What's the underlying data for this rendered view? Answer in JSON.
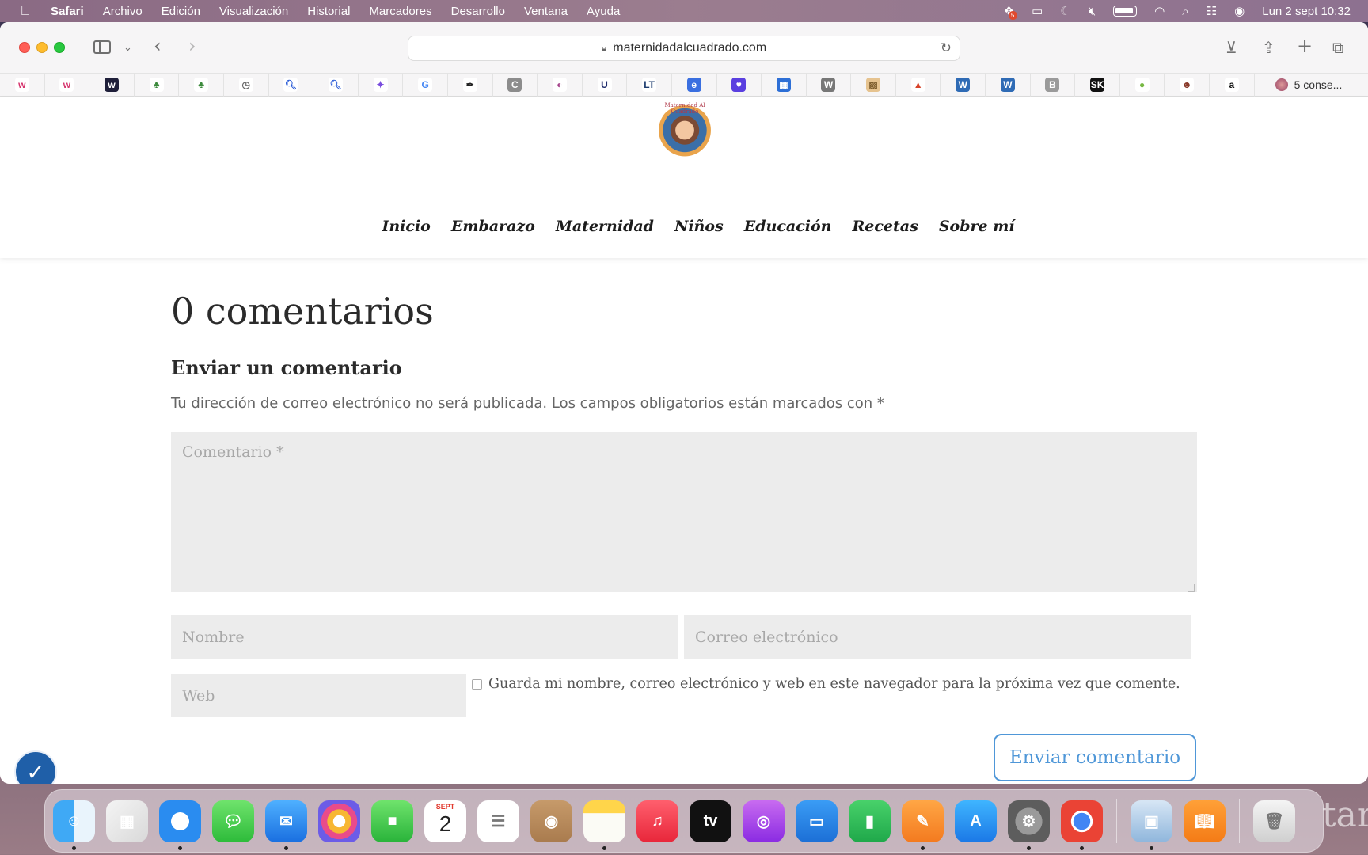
{
  "menubar": {
    "app": "Safari",
    "items": [
      "Archivo",
      "Edición",
      "Visualización",
      "Historial",
      "Marcadores",
      "Desarrollo",
      "Ventana",
      "Ayuda"
    ],
    "badge_count": "5",
    "clock": "Lun 2 sept 10:32"
  },
  "browser": {
    "url": "maternidadalcuadrado.com",
    "tab_label": "5 conse..."
  },
  "favorites": [
    {
      "icon": "w-red-icon",
      "glyph": "w",
      "color": "#ffffff",
      "fg": "#d6336c"
    },
    {
      "icon": "w-red-icon",
      "glyph": "w",
      "color": "#ffffff",
      "fg": "#d6336c"
    },
    {
      "icon": "w-dark-icon",
      "glyph": "w",
      "color": "#1f1f3a",
      "fg": "#ffffff"
    },
    {
      "icon": "cactus-icon",
      "glyph": "♣",
      "color": "#ffffff",
      "fg": "#3c8a3c"
    },
    {
      "icon": "cactus-icon",
      "glyph": "♣",
      "color": "#ffffff",
      "fg": "#3c8a3c"
    },
    {
      "icon": "clock-icon",
      "glyph": "◷",
      "color": "#ffffff",
      "fg": "#666666"
    },
    {
      "icon": "search-icon",
      "glyph": "🔍︎",
      "color": "#ffffff",
      "fg": "#2a5bd7"
    },
    {
      "icon": "search-icon",
      "glyph": "🔍︎",
      "color": "#ffffff",
      "fg": "#2a5bd7"
    },
    {
      "icon": "copilot-icon",
      "glyph": "✦",
      "color": "#ffffff",
      "fg": "#7a4dde"
    },
    {
      "icon": "google-icon",
      "glyph": "G",
      "color": "#ffffff",
      "fg": "#4285f4"
    },
    {
      "icon": "quill-icon",
      "glyph": "✒",
      "color": "#ffffff",
      "fg": "#222222"
    },
    {
      "icon": "c-grey-icon",
      "glyph": "C",
      "color": "#8c8c8c",
      "fg": "#ffffff"
    },
    {
      "icon": "ball-icon",
      "glyph": "◐",
      "color": "#ffffff",
      "fg": "#a4418a"
    },
    {
      "icon": "u-icon",
      "glyph": "U",
      "color": "#ffffff",
      "fg": "#1d2a6b"
    },
    {
      "icon": "lt-icon",
      "glyph": "LT",
      "color": "#ffffff",
      "fg": "#1c3b6e"
    },
    {
      "icon": "c-blue-icon",
      "glyph": "e",
      "color": "#3a6fe0",
      "fg": "#ffffff"
    },
    {
      "icon": "heart-chat-icon",
      "glyph": "♥",
      "color": "#5a3fe0",
      "fg": "#ffffff"
    },
    {
      "icon": "chart-icon",
      "glyph": "▦",
      "color": "#2d6fd6",
      "fg": "#ffffff"
    },
    {
      "icon": "wordpress-icon",
      "glyph": "W",
      "color": "#777777",
      "fg": "#ffffff"
    },
    {
      "icon": "image-icon",
      "glyph": "▨",
      "color": "#e6c38f",
      "fg": "#7a5a2a"
    },
    {
      "icon": "triangle-icon",
      "glyph": "▲",
      "color": "#ffffff",
      "fg": "#d8432a"
    },
    {
      "icon": "wordpress-icon",
      "glyph": "W",
      "color": "#2f6bb5",
      "fg": "#ffffff"
    },
    {
      "icon": "wordpress-icon",
      "glyph": "W",
      "color": "#2f6bb5",
      "fg": "#ffffff"
    },
    {
      "icon": "b-icon",
      "glyph": "B",
      "color": "#9a9a9a",
      "fg": "#ffffff"
    },
    {
      "icon": "sk-icon",
      "glyph": "SK",
      "color": "#111111",
      "fg": "#ffffff"
    },
    {
      "icon": "android-icon",
      "glyph": "●",
      "color": "#ffffff",
      "fg": "#77b843"
    },
    {
      "icon": "person-icon",
      "glyph": "☻",
      "color": "#ffffff",
      "fg": "#8a3a2a"
    },
    {
      "icon": "amazon-icon",
      "glyph": "a",
      "color": "#ffffff",
      "fg": "#111111"
    }
  ],
  "site": {
    "logo_text": "Maternidad Al Cuadrado",
    "nav": [
      "Inicio",
      "Embarazo",
      "Maternidad",
      "Niños",
      "Educación",
      "Recetas",
      "Sobre mí"
    ]
  },
  "comments": {
    "count_title": "0 comentarios",
    "reply_title": "Enviar un comentario",
    "notes": "Tu dirección de correo electrónico no será publicada. Los campos obligatorios están marcados con *",
    "comment_placeholder": "Comentario *",
    "name_placeholder": "Nombre",
    "email_placeholder": "Correo electrónico",
    "web_placeholder": "Web",
    "cookie_label": "Guarda mi nombre, correo electrónico y web en este navegador para la próxima vez que comente.",
    "submit_label": "Enviar comentario"
  },
  "dock": {
    "calendar_month": "SEPT",
    "calendar_day": "2",
    "appletv_label": "tv",
    "apps": [
      {
        "name": "finder-icon",
        "bg": "linear-gradient(90deg,#3fa9f5 50%,#e9f4fc 50%)",
        "glyph": "☺",
        "running": true
      },
      {
        "name": "launchpad-icon",
        "bg": "linear-gradient(135deg,#f4f4f4,#d9d9d9)",
        "glyph": "▦",
        "running": false
      },
      {
        "name": "safari-icon",
        "bg": "radial-gradient(#ffffff 0 30%,#2a8cf0 31%)",
        "glyph": "✦",
        "running": true
      },
      {
        "name": "messages-icon",
        "bg": "linear-gradient(#6fe36c,#2dbb3a)",
        "glyph": "💬︎",
        "running": false
      },
      {
        "name": "mail-icon",
        "bg": "linear-gradient(#4fb0ff,#1a6fe0)",
        "glyph": "✉",
        "running": true
      },
      {
        "name": "photos-icon",
        "bg": "radial-gradient(#fff 0 20%,#f7b733 21% 40%,#e94b8a 41% 60%,#6c5ce7 61%)",
        "glyph": "",
        "running": false
      },
      {
        "name": "facetime-icon",
        "bg": "linear-gradient(#6fe36c,#29b33a)",
        "glyph": "■",
        "running": false
      },
      {
        "name": "calendar-icon",
        "bg": "#ffffff",
        "glyph": "",
        "running": false
      },
      {
        "name": "reminders-icon",
        "bg": "#ffffff",
        "glyph": "☰",
        "running": false
      },
      {
        "name": "contacts-icon",
        "bg": "linear-gradient(#c69a6a,#a97b4e)",
        "glyph": "◉",
        "running": false
      },
      {
        "name": "notes-icon",
        "bg": "linear-gradient(#ffd54a 0 30%,#fbfbf5 31%)",
        "glyph": "",
        "running": true
      },
      {
        "name": "music-icon",
        "bg": "linear-gradient(#ff5f6d,#e8263a)",
        "glyph": "♫",
        "running": false
      },
      {
        "name": "appletv-icon",
        "bg": "#111111",
        "glyph": "",
        "running": false
      },
      {
        "name": "podcasts-icon",
        "bg": "linear-gradient(#c86bf0,#8a2be2)",
        "glyph": "◎",
        "running": false
      },
      {
        "name": "keynote-icon",
        "bg": "linear-gradient(#3a9cf5,#1c6fd6)",
        "glyph": "▭",
        "running": false
      },
      {
        "name": "numbers-icon",
        "bg": "linear-gradient(#48d16a,#1fa84a)",
        "glyph": "▮",
        "running": false
      },
      {
        "name": "pages-icon",
        "bg": "linear-gradient(#ffa645,#f37a1f)",
        "glyph": "✎",
        "running": true
      },
      {
        "name": "appstore-icon",
        "bg": "linear-gradient(#3fb5ff,#1b78e6)",
        "glyph": "A",
        "running": false
      },
      {
        "name": "settings-icon",
        "bg": "radial-gradient(#9a9a9a 0 45%,#5d5d5d 46%)",
        "glyph": "⚙",
        "running": true
      },
      {
        "name": "chrome-icon",
        "bg": "radial-gradient(#4285f4 0 28%,#ffffff 29% 36%,#ea4335 37%)",
        "glyph": "",
        "running": true
      }
    ],
    "extras": [
      {
        "name": "preview-icon",
        "bg": "linear-gradient(#d7e6f5,#8fb6dc)",
        "glyph": "▣",
        "running": true
      },
      {
        "name": "books-icon",
        "bg": "linear-gradient(#ffa037,#f47b16)",
        "glyph": "📖︎",
        "running": false
      }
    ],
    "trash": {
      "name": "trash-icon",
      "bg": "linear-gradient(#f4f4f4,#cfcfcf)",
      "glyph": "🗑︎",
      "running": false
    },
    "desktop_text": "tar"
  }
}
